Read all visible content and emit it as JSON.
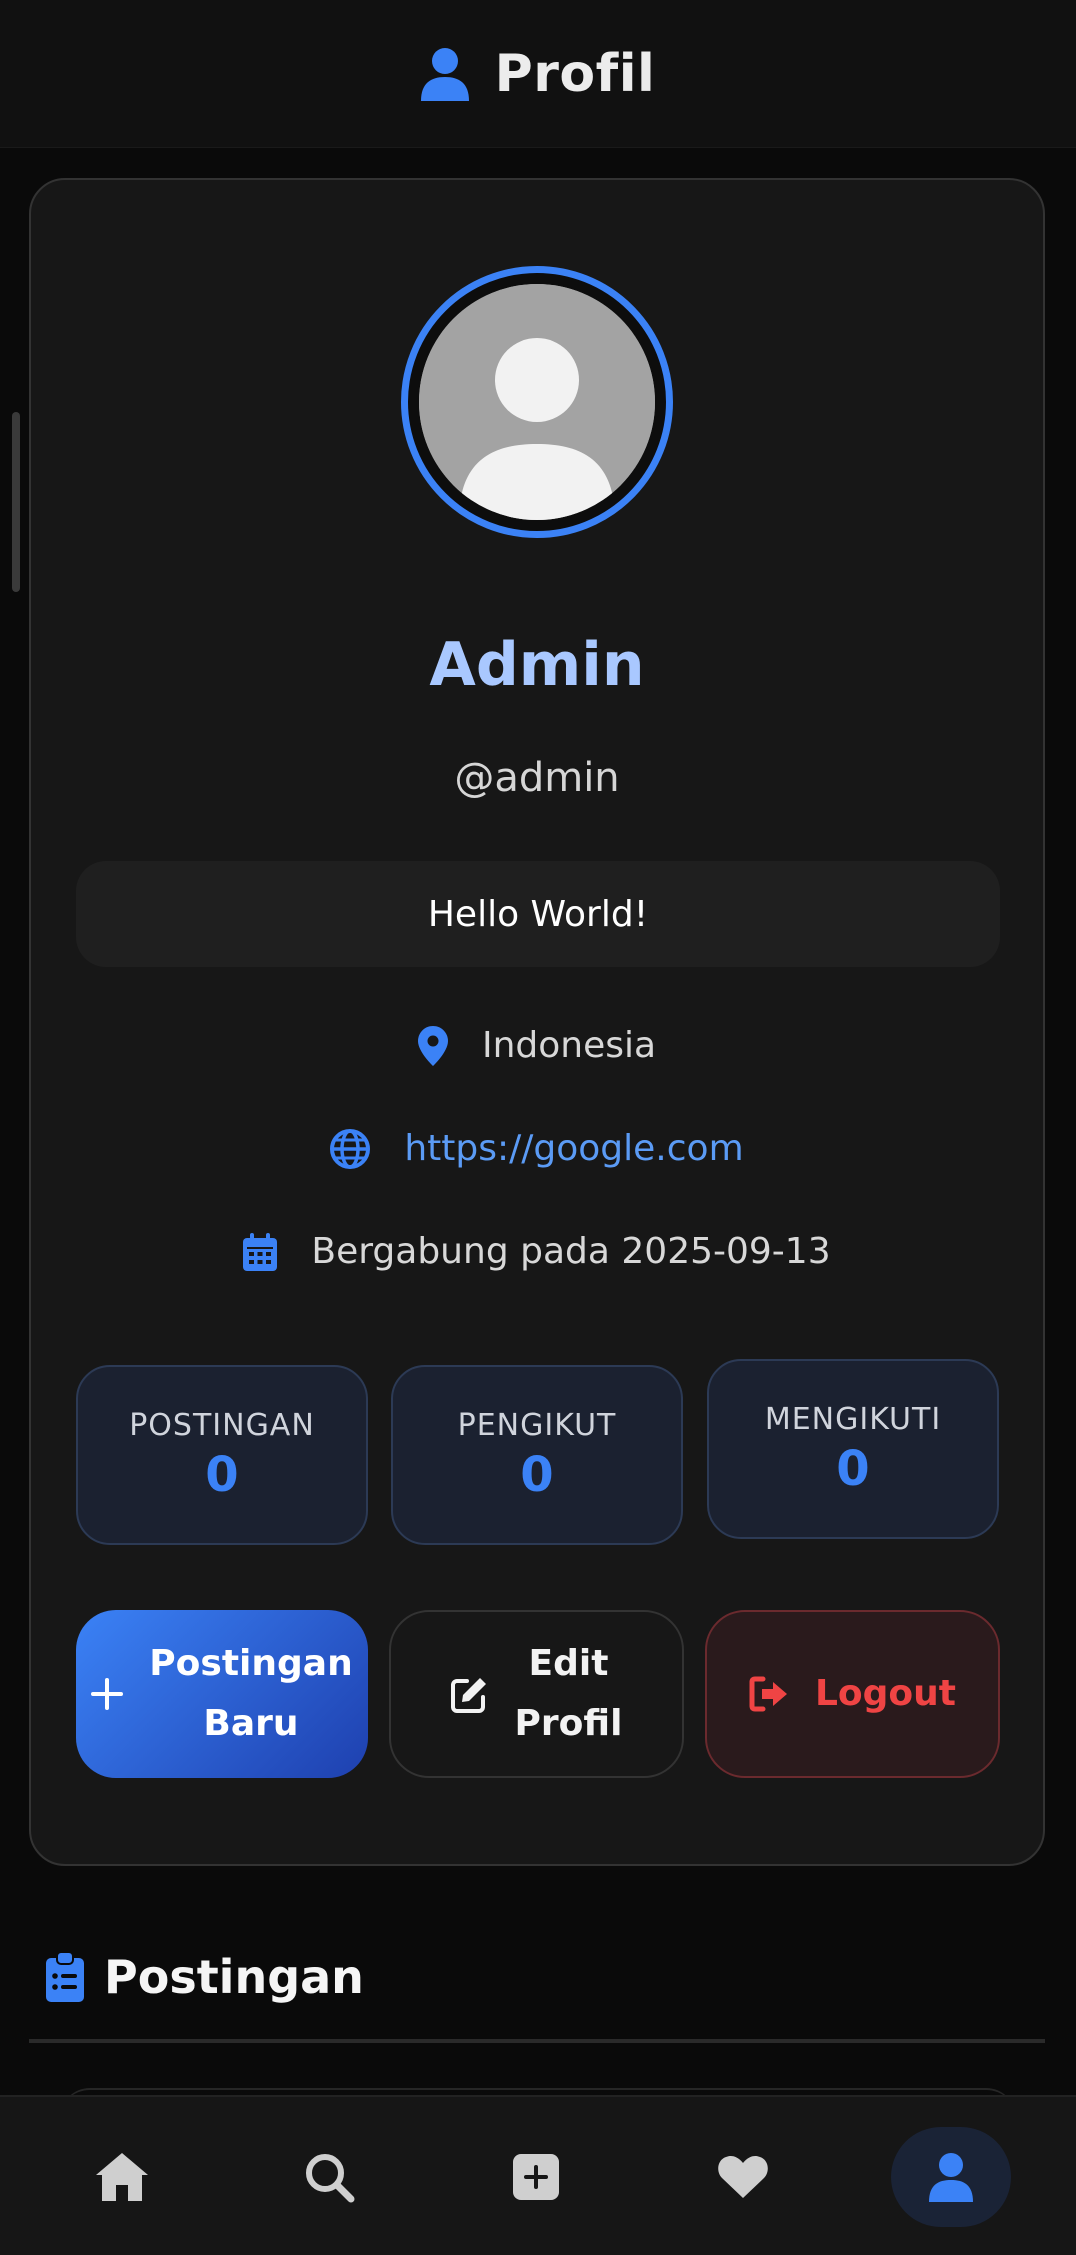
{
  "header": {
    "title": "Profil",
    "icon": "user-icon",
    "accent": "#3b82f6"
  },
  "profile": {
    "name": "Admin",
    "username": "@admin",
    "bio": "Hello World!",
    "location": "Indonesia",
    "website": "https://google.com",
    "joined": "Bergabung pada 2025-09-13"
  },
  "stats": [
    {
      "label": "POSTINGAN",
      "value": "0"
    },
    {
      "label": "PENGIKUT",
      "value": "0"
    },
    {
      "label": "MENGIKUTI",
      "value": "0"
    }
  ],
  "actions": {
    "new_post_line1": "Postingan",
    "new_post_line2": "Baru",
    "edit_line1": "Edit",
    "edit_line2": "Profil",
    "logout": "Logout"
  },
  "posts_section": {
    "title": "Postingan",
    "icon": "clipboard-list-icon"
  },
  "bottom_nav": [
    {
      "icon": "home-icon",
      "active": false
    },
    {
      "icon": "search-icon",
      "active": false
    },
    {
      "icon": "plus-square-icon",
      "active": false
    },
    {
      "icon": "heart-icon",
      "active": false
    },
    {
      "icon": "user-icon",
      "active": true
    }
  ],
  "colors": {
    "accent": "#3b82f6",
    "danger": "#ef4444",
    "background": "#0a0a0a",
    "card": "#171717"
  }
}
